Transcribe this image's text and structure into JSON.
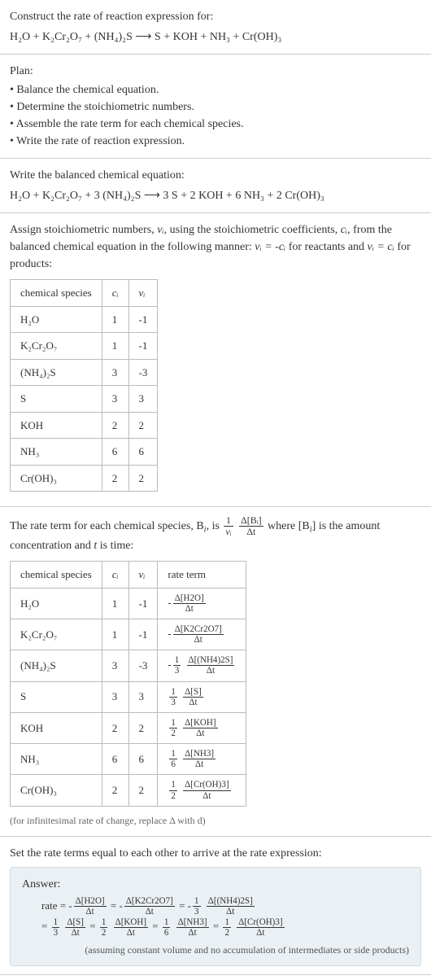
{
  "chart_data": {
    "type": "table",
    "tables": [
      {
        "title": "Stoichiometric numbers",
        "columns": [
          "chemical species",
          "c_i",
          "ν_i"
        ],
        "rows": [
          [
            "H₂O",
            "1",
            "-1"
          ],
          [
            "K₂Cr₂O₇",
            "1",
            "-1"
          ],
          [
            "(NH₄)₂S",
            "3",
            "-3"
          ],
          [
            "S",
            "3",
            "3"
          ],
          [
            "KOH",
            "2",
            "2"
          ],
          [
            "NH₃",
            "6",
            "6"
          ],
          [
            "Cr(OH)₃",
            "2",
            "2"
          ]
        ]
      },
      {
        "title": "Rate terms",
        "columns": [
          "chemical species",
          "c_i",
          "ν_i",
          "rate term"
        ],
        "rows": [
          [
            "H₂O",
            "1",
            "-1",
            "-Δ[H2O]/Δt"
          ],
          [
            "K₂Cr₂O₇",
            "1",
            "-1",
            "-Δ[K2Cr2O7]/Δt"
          ],
          [
            "(NH₄)₂S",
            "3",
            "-3",
            "-(1/3) Δ[(NH4)2S]/Δt"
          ],
          [
            "S",
            "3",
            "3",
            "(1/3) Δ[S]/Δt"
          ],
          [
            "KOH",
            "2",
            "2",
            "(1/2) Δ[KOH]/Δt"
          ],
          [
            "NH₃",
            "6",
            "6",
            "(1/6) Δ[NH3]/Δt"
          ],
          [
            "Cr(OH)₃",
            "2",
            "2",
            "(1/2) Δ[Cr(OH)3]/Δt"
          ]
        ]
      }
    ]
  },
  "prompt": {
    "title": "Construct the rate of reaction expression for:",
    "equation": "H₂O + K₂Cr₂O₇ + (NH₄)₂S  ⟶  S + KOH + NH₃ + Cr(OH)₃"
  },
  "plan": {
    "title": "Plan:",
    "items": [
      "• Balance the chemical equation.",
      "• Determine the stoichiometric numbers.",
      "• Assemble the rate term for each chemical species.",
      "• Write the rate of reaction expression."
    ]
  },
  "balanced": {
    "title": "Write the balanced chemical equation:",
    "equation": "H₂O + K₂Cr₂O₇ + 3 (NH₄)₂S  ⟶  3 S + 2 KOH + 6 NH₃ + 2 Cr(OH)₃"
  },
  "stoich": {
    "intro_a": "Assign stoichiometric numbers, ",
    "intro_b": ", using the stoichiometric coefficients, ",
    "intro_c": ", from the balanced chemical equation in the following manner: ",
    "intro_d": " for reactants and ",
    "intro_e": " for products:",
    "nu_i": "νᵢ",
    "c_i": "cᵢ",
    "rel_react": "νᵢ = -cᵢ",
    "rel_prod": "νᵢ = cᵢ",
    "headers": {
      "species": "chemical species",
      "ci": "cᵢ",
      "nui": "νᵢ"
    },
    "rows": [
      {
        "sp": "H₂O",
        "c": "1",
        "n": "-1"
      },
      {
        "sp": "K₂Cr₂O₇",
        "c": "1",
        "n": "-1"
      },
      {
        "sp": "(NH₄)₂S",
        "c": "3",
        "n": "-3"
      },
      {
        "sp": "S",
        "c": "3",
        "n": "3"
      },
      {
        "sp": "KOH",
        "c": "2",
        "n": "2"
      },
      {
        "sp": "NH₃",
        "c": "6",
        "n": "6"
      },
      {
        "sp": "Cr(OH)₃",
        "c": "2",
        "n": "2"
      }
    ]
  },
  "rateterm": {
    "intro_a": "The rate term for each chemical species, B",
    "intro_b": ", is ",
    "intro_c": " where [B",
    "intro_d": "] is the amount concentration and ",
    "intro_e": " is time:",
    "i": "i",
    "t": "t",
    "frac1_num": "1",
    "frac1_den": "νᵢ",
    "frac2_num": "Δ[Bᵢ]",
    "frac2_den": "Δt",
    "headers": {
      "species": "chemical species",
      "ci": "cᵢ",
      "nui": "νᵢ",
      "rate": "rate term"
    },
    "rows": [
      {
        "sp": "H₂O",
        "c": "1",
        "n": "-1",
        "pre": "-",
        "cn": "",
        "cd": "",
        "num": "Δ[H2O]",
        "den": "Δt"
      },
      {
        "sp": "K₂Cr₂O₇",
        "c": "1",
        "n": "-1",
        "pre": "-",
        "cn": "",
        "cd": "",
        "num": "Δ[K2Cr2O7]",
        "den": "Δt"
      },
      {
        "sp": "(NH₄)₂S",
        "c": "3",
        "n": "-3",
        "pre": "-",
        "cn": "1",
        "cd": "3",
        "num": "Δ[(NH4)2S]",
        "den": "Δt"
      },
      {
        "sp": "S",
        "c": "3",
        "n": "3",
        "pre": "",
        "cn": "1",
        "cd": "3",
        "num": "Δ[S]",
        "den": "Δt"
      },
      {
        "sp": "KOH",
        "c": "2",
        "n": "2",
        "pre": "",
        "cn": "1",
        "cd": "2",
        "num": "Δ[KOH]",
        "den": "Δt"
      },
      {
        "sp": "NH₃",
        "c": "6",
        "n": "6",
        "pre": "",
        "cn": "1",
        "cd": "6",
        "num": "Δ[NH3]",
        "den": "Δt"
      },
      {
        "sp": "Cr(OH)₃",
        "c": "2",
        "n": "2",
        "pre": "",
        "cn": "1",
        "cd": "2",
        "num": "Δ[Cr(OH)3]",
        "den": "Δt"
      }
    ],
    "note": "(for infinitesimal rate of change, replace Δ with d)"
  },
  "final": {
    "intro": "Set the rate terms equal to each other to arrive at the rate expression:",
    "answer_label": "Answer:",
    "rate_label": "rate = ",
    "eq": " = ",
    "terms": [
      {
        "pre": "-",
        "cn": "",
        "cd": "",
        "num": "Δ[H2O]",
        "den": "Δt"
      },
      {
        "pre": "-",
        "cn": "",
        "cd": "",
        "num": "Δ[K2Cr2O7]",
        "den": "Δt"
      },
      {
        "pre": "-",
        "cn": "1",
        "cd": "3",
        "num": "Δ[(NH4)2S]",
        "den": "Δt"
      },
      {
        "pre": "",
        "cn": "1",
        "cd": "3",
        "num": "Δ[S]",
        "den": "Δt"
      },
      {
        "pre": "",
        "cn": "1",
        "cd": "2",
        "num": "Δ[KOH]",
        "den": "Δt"
      },
      {
        "pre": "",
        "cn": "1",
        "cd": "6",
        "num": "Δ[NH3]",
        "den": "Δt"
      },
      {
        "pre": "",
        "cn": "1",
        "cd": "2",
        "num": "Δ[Cr(OH)3]",
        "den": "Δt"
      }
    ],
    "note": "(assuming constant volume and no accumulation of intermediates or side products)"
  }
}
